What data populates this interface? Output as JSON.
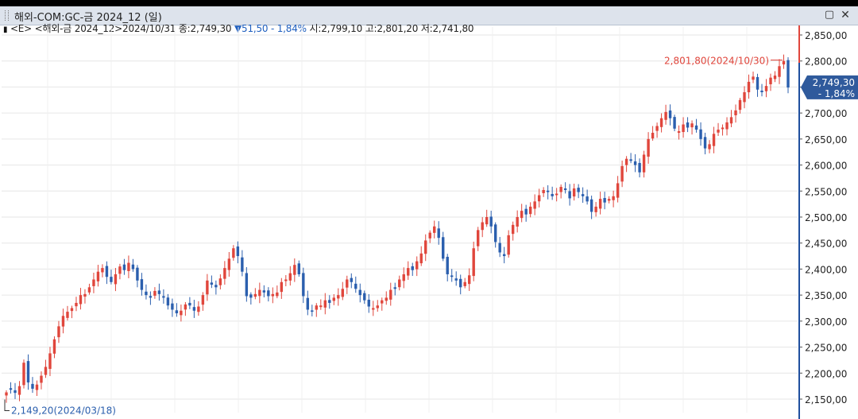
{
  "window": {
    "title": "해외-COM:GC-금 2024_12 (일)",
    "restore_icon": "restore-window-icon",
    "close_icon": "close-window-icon"
  },
  "info": {
    "marker": "▮",
    "label": "<E> <해외-금 2024_12>2024/10/31",
    "close_label": "종:",
    "close": "2,749,30",
    "change": "▼51,50",
    "change_pct": "- 1,84%",
    "open_label": "시:",
    "open": "2,799,10",
    "high_label": "고:",
    "high": "2,801,20",
    "low_label": "저:",
    "low": "2,741,80"
  },
  "colors": {
    "up": "#e0463c",
    "down": "#2b5fae",
    "grid": "#e6e6e6",
    "axis": "#1f4f9e",
    "badge_bg": "#2f5a9c"
  },
  "chart_data": {
    "type": "candlestick",
    "ylim": [
      2130,
      2865
    ],
    "yticks": [
      "2,850,00",
      "2,800,00",
      "2,750,00",
      "2,700,00",
      "2,650,00",
      "2,600,00",
      "2,550,00",
      "2,500,00",
      "2,450,00",
      "2,400,00",
      "2,350,00",
      "2,300,00",
      "2,250,00",
      "2,200,00",
      "2,150,00"
    ],
    "ytick_values": [
      2850,
      2800,
      2750,
      2700,
      2650,
      2600,
      2550,
      2500,
      2450,
      2400,
      2350,
      2300,
      2250,
      2200,
      2150
    ],
    "max_label": "2,801,80(2024/10/30)",
    "max_value": 2801.8,
    "min_label": "2,149,20(2024/03/18)",
    "min_value": 2149.2,
    "last_price_label": "2,749,30",
    "last_change_label": "- 1,84%",
    "last_value": 2749.3,
    "closes": [
      2163,
      2168,
      2162,
      2175,
      2220,
      2182,
      2170,
      2178,
      2195,
      2212,
      2238,
      2265,
      2290,
      2310,
      2318,
      2325,
      2335,
      2350,
      2352,
      2365,
      2380,
      2395,
      2402,
      2385,
      2375,
      2390,
      2405,
      2398,
      2412,
      2400,
      2378,
      2360,
      2350,
      2345,
      2358,
      2352,
      2345,
      2330,
      2322,
      2315,
      2320,
      2332,
      2330,
      2320,
      2328,
      2350,
      2378,
      2370,
      2365,
      2382,
      2402,
      2420,
      2440,
      2425,
      2395,
      2348,
      2345,
      2352,
      2360,
      2355,
      2348,
      2352,
      2355,
      2375,
      2380,
      2392,
      2408,
      2390,
      2348,
      2322,
      2318,
      2330,
      2330,
      2340,
      2335,
      2345,
      2350,
      2362,
      2380,
      2375,
      2362,
      2350,
      2340,
      2328,
      2325,
      2330,
      2340,
      2345,
      2360,
      2362,
      2380,
      2390,
      2402,
      2398,
      2415,
      2430,
      2455,
      2470,
      2482,
      2460,
      2420,
      2390,
      2385,
      2378,
      2365,
      2375,
      2388,
      2440,
      2475,
      2490,
      2500,
      2482,
      2452,
      2432,
      2425,
      2465,
      2485,
      2500,
      2512,
      2505,
      2520,
      2530,
      2542,
      2552,
      2548,
      2540,
      2545,
      2558,
      2552,
      2536,
      2555,
      2548,
      2540,
      2530,
      2510,
      2520,
      2535,
      2528,
      2535,
      2540,
      2565,
      2598,
      2612,
      2608,
      2600,
      2586,
      2620,
      2650,
      2662,
      2675,
      2690,
      2702,
      2690,
      2670,
      2665,
      2678,
      2672,
      2680,
      2668,
      2650,
      2632,
      2640,
      2660,
      2668,
      2672,
      2682,
      2692,
      2705,
      2725,
      2740,
      2760,
      2770,
      2745,
      2740,
      2752,
      2768,
      2772,
      2790,
      2800,
      2749
    ]
  }
}
